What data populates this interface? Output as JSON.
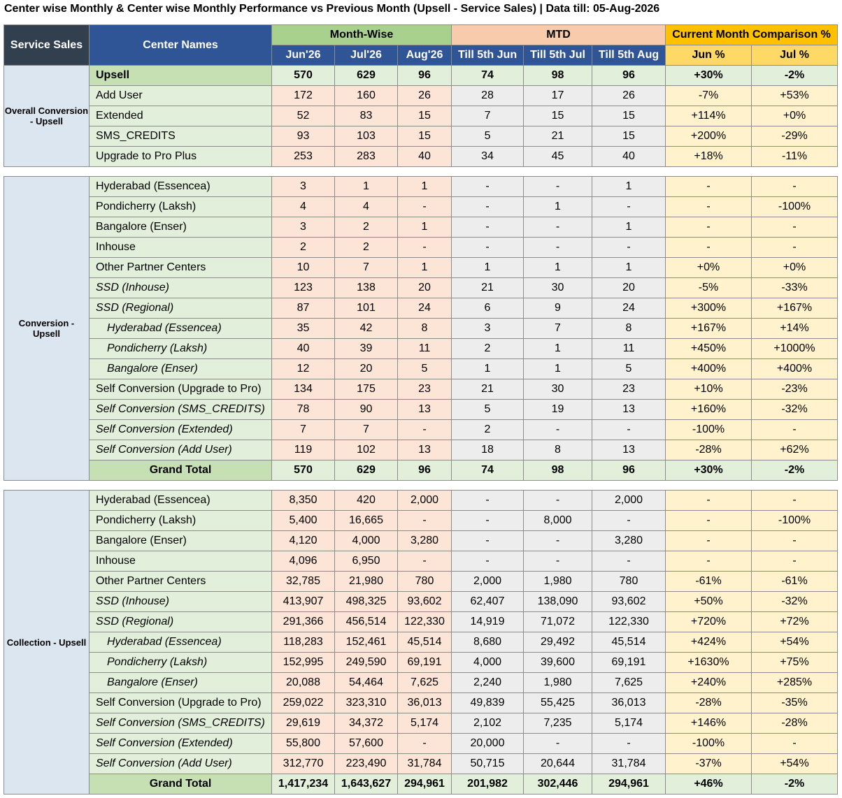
{
  "title": "Center wise Monthly & Center wise Monthly Performance vs Previous Month (Upsell - Service Sales) | Data till: 05-Aug-2026",
  "header": {
    "service_sales": "Service Sales",
    "center_names": "Center Names",
    "month_wise": "Month-Wise",
    "mtd": "MTD",
    "comparison": "Current Month Comparison %",
    "month_cols": [
      "Jun'26",
      "Jul'26",
      "Aug'26"
    ],
    "mtd_cols": [
      "Till 5th Jun",
      "Till 5th Jul",
      "Till 5th Aug"
    ],
    "cmp_cols": [
      "Jun %",
      "Jul %"
    ]
  },
  "colors": {
    "service_sales_header": "#323f4f",
    "center_header": "#2f5597",
    "month_wise_header": "#a9d18e",
    "mtd_header": "#f8cbad",
    "comparison_header": "#ffc000",
    "name_cell": "#e2efda",
    "month_cell": "#fce4d6",
    "mtd_cell": "#ededed",
    "comparison_cell": "#fff2cc"
  },
  "sections": [
    {
      "label": "Overall Conversion - Upsell",
      "rows": [
        {
          "name": "Upsell",
          "style": "upsell",
          "values": [
            "570",
            "629",
            "96",
            "74",
            "98",
            "96",
            "+30%",
            "-2%"
          ]
        },
        {
          "name": "Add User",
          "style": "",
          "values": [
            "172",
            "160",
            "26",
            "28",
            "17",
            "26",
            "-7%",
            "+53%"
          ]
        },
        {
          "name": "Extended",
          "style": "",
          "values": [
            "52",
            "83",
            "15",
            "7",
            "15",
            "15",
            "+114%",
            "+0%"
          ]
        },
        {
          "name": "SMS_CREDITS",
          "style": "",
          "values": [
            "93",
            "103",
            "15",
            "5",
            "21",
            "15",
            "+200%",
            "-29%"
          ]
        },
        {
          "name": "Upgrade to Pro Plus",
          "style": "",
          "values": [
            "253",
            "283",
            "40",
            "34",
            "45",
            "40",
            "+18%",
            "-11%"
          ]
        }
      ]
    },
    {
      "label": "Conversion - Upsell",
      "rows": [
        {
          "name": "Hyderabad (Essencea)",
          "style": "",
          "values": [
            "3",
            "1",
            "1",
            "-",
            "-",
            "1",
            "-",
            "-"
          ]
        },
        {
          "name": "Pondicherry (Laksh)",
          "style": "",
          "values": [
            "4",
            "4",
            "-",
            "-",
            "1",
            "-",
            "-",
            "-100%"
          ]
        },
        {
          "name": "Bangalore (Enser)",
          "style": "",
          "values": [
            "3",
            "2",
            "1",
            "-",
            "-",
            "1",
            "-",
            "-"
          ]
        },
        {
          "name": "Inhouse",
          "style": "",
          "values": [
            "2",
            "2",
            "-",
            "-",
            "-",
            "-",
            "-",
            "-"
          ]
        },
        {
          "name": "Other Partner Centers",
          "style": "",
          "values": [
            "10",
            "7",
            "1",
            "1",
            "1",
            "1",
            "+0%",
            "+0%"
          ]
        },
        {
          "name": "SSD (Inhouse)",
          "style": "it",
          "values": [
            "123",
            "138",
            "20",
            "21",
            "30",
            "20",
            "-5%",
            "-33%"
          ]
        },
        {
          "name": "SSD (Regional)",
          "style": "it",
          "values": [
            "87",
            "101",
            "24",
            "6",
            "9",
            "24",
            "+300%",
            "+167%"
          ]
        },
        {
          "name": "Hyderabad (Essencea)",
          "style": "it sub",
          "values": [
            "35",
            "42",
            "8",
            "3",
            "7",
            "8",
            "+167%",
            "+14%"
          ]
        },
        {
          "name": "Pondicherry (Laksh)",
          "style": "it sub",
          "values": [
            "40",
            "39",
            "11",
            "2",
            "1",
            "11",
            "+450%",
            "+1000%"
          ]
        },
        {
          "name": "Bangalore (Enser)",
          "style": "it sub",
          "values": [
            "12",
            "20",
            "5",
            "1",
            "1",
            "5",
            "+400%",
            "+400%"
          ]
        },
        {
          "name": "Self Conversion (Upgrade to Pro)",
          "style": "",
          "values": [
            "134",
            "175",
            "23",
            "21",
            "30",
            "23",
            "+10%",
            "-23%"
          ]
        },
        {
          "name": "Self Conversion (SMS_CREDITS)",
          "style": "it",
          "values": [
            "78",
            "90",
            "13",
            "5",
            "19",
            "13",
            "+160%",
            "-32%"
          ]
        },
        {
          "name": "Self Conversion (Extended)",
          "style": "it",
          "values": [
            "7",
            "7",
            "-",
            "2",
            "-",
            "-",
            "-100%",
            "-"
          ]
        },
        {
          "name": "Self Conversion (Add User)",
          "style": "it",
          "values": [
            "119",
            "102",
            "13",
            "18",
            "8",
            "13",
            "-28%",
            "+62%"
          ]
        },
        {
          "name": "Grand Total",
          "style": "total",
          "values": [
            "570",
            "629",
            "96",
            "74",
            "98",
            "96",
            "+30%",
            "-2%"
          ]
        }
      ]
    },
    {
      "label": "Collection - Upsell",
      "rows": [
        {
          "name": "Hyderabad (Essencea)",
          "style": "",
          "values": [
            "8,350",
            "420",
            "2,000",
            "-",
            "-",
            "2,000",
            "-",
            "-"
          ]
        },
        {
          "name": "Pondicherry (Laksh)",
          "style": "",
          "values": [
            "5,400",
            "16,665",
            "-",
            "-",
            "8,000",
            "-",
            "-",
            "-100%"
          ]
        },
        {
          "name": "Bangalore (Enser)",
          "style": "",
          "values": [
            "4,120",
            "4,000",
            "3,280",
            "-",
            "-",
            "3,280",
            "-",
            "-"
          ]
        },
        {
          "name": "Inhouse",
          "style": "",
          "values": [
            "4,096",
            "6,950",
            "-",
            "-",
            "-",
            "-",
            "-",
            "-"
          ]
        },
        {
          "name": "Other Partner Centers",
          "style": "",
          "values": [
            "32,785",
            "21,980",
            "780",
            "2,000",
            "1,980",
            "780",
            "-61%",
            "-61%"
          ]
        },
        {
          "name": "SSD (Inhouse)",
          "style": "it",
          "values": [
            "413,907",
            "498,325",
            "93,602",
            "62,407",
            "138,090",
            "93,602",
            "+50%",
            "-32%"
          ]
        },
        {
          "name": "SSD (Regional)",
          "style": "it",
          "values": [
            "291,366",
            "456,514",
            "122,330",
            "14,919",
            "71,072",
            "122,330",
            "+720%",
            "+72%"
          ]
        },
        {
          "name": "Hyderabad (Essencea)",
          "style": "it sub",
          "values": [
            "118,283",
            "152,461",
            "45,514",
            "8,680",
            "29,492",
            "45,514",
            "+424%",
            "+54%"
          ]
        },
        {
          "name": "Pondicherry (Laksh)",
          "style": "it sub",
          "values": [
            "152,995",
            "249,590",
            "69,191",
            "4,000",
            "39,600",
            "69,191",
            "+1630%",
            "+75%"
          ]
        },
        {
          "name": "Bangalore (Enser)",
          "style": "it sub",
          "values": [
            "20,088",
            "54,464",
            "7,625",
            "2,240",
            "1,980",
            "7,625",
            "+240%",
            "+285%"
          ]
        },
        {
          "name": "Self Conversion (Upgrade to Pro)",
          "style": "",
          "values": [
            "259,022",
            "323,310",
            "36,013",
            "49,839",
            "55,425",
            "36,013",
            "-28%",
            "-35%"
          ]
        },
        {
          "name": "Self Conversion (SMS_CREDITS)",
          "style": "it",
          "values": [
            "29,619",
            "34,372",
            "5,174",
            "2,102",
            "7,235",
            "5,174",
            "+146%",
            "-28%"
          ]
        },
        {
          "name": "Self Conversion (Extended)",
          "style": "it",
          "values": [
            "55,800",
            "57,600",
            "-",
            "20,000",
            "-",
            "-",
            "-100%",
            "-"
          ]
        },
        {
          "name": "Self Conversion (Add User)",
          "style": "it",
          "values": [
            "312,770",
            "223,490",
            "31,784",
            "50,715",
            "20,644",
            "31,784",
            "-37%",
            "+54%"
          ]
        },
        {
          "name": "Grand Total",
          "style": "total",
          "values": [
            "1,417,234",
            "1,643,627",
            "294,961",
            "201,982",
            "302,446",
            "294,961",
            "+46%",
            "-2%"
          ]
        }
      ]
    }
  ]
}
